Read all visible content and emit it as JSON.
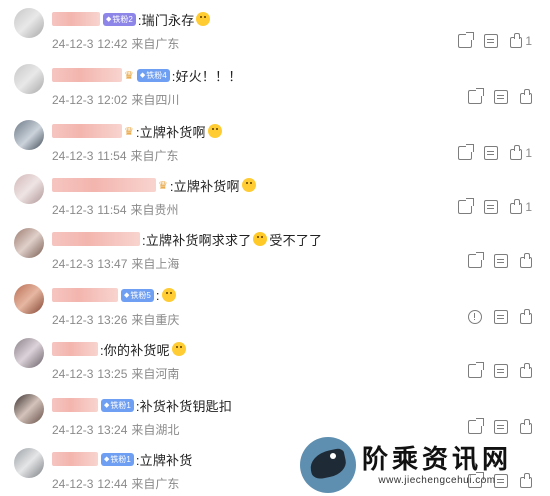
{
  "comments": [
    {
      "text": ":瑞门永存",
      "badge": "铁粉2",
      "badge_color": "purple",
      "crown": false,
      "emoji": "thumbs-up",
      "date": "24-12-3",
      "time": "12:42",
      "location": "来自广东",
      "actions": [
        "share",
        "reply",
        "like"
      ],
      "like_count": "1"
    },
    {
      "text": ":好火！！！",
      "badge": "铁粉4",
      "badge_color": "blue",
      "crown": true,
      "emoji": "",
      "date": "24-12-3",
      "time": "12:02",
      "location": "来自四川",
      "actions": [
        "share",
        "reply",
        "like"
      ],
      "like_count": ""
    },
    {
      "text": ":立牌补货啊",
      "badge": "",
      "badge_color": "",
      "crown": true,
      "emoji": "smile",
      "date": "24-12-3",
      "time": "11:54",
      "location": "来自广东",
      "actions": [
        "share",
        "reply",
        "like"
      ],
      "like_count": "1"
    },
    {
      "text": ":立牌补货啊",
      "badge": "",
      "badge_color": "",
      "crown": true,
      "emoji": "smile",
      "date": "24-12-3",
      "time": "11:54",
      "location": "来自贵州",
      "actions": [
        "share",
        "reply",
        "like"
      ],
      "like_count": "1"
    },
    {
      "text": ":立牌补货啊求求了",
      "text2": "受不了了",
      "badge": "",
      "badge_color": "",
      "crown": false,
      "emoji": "cry",
      "date": "24-12-3",
      "time": "13:47",
      "location": "来自上海",
      "actions": [
        "share",
        "reply",
        "like"
      ],
      "like_count": ""
    },
    {
      "text": ":",
      "badge": "铁粉5",
      "badge_color": "blue",
      "crown": false,
      "emoji": "smile",
      "date": "24-12-3",
      "time": "13:26",
      "location": "来自重庆",
      "actions": [
        "report",
        "reply",
        "like"
      ],
      "like_count": ""
    },
    {
      "text": ":你的补货呢",
      "badge": "",
      "badge_color": "",
      "crown": false,
      "emoji": "smile",
      "date": "24-12-3",
      "time": "13:25",
      "location": "来自河南",
      "actions": [
        "share",
        "reply",
        "like"
      ],
      "like_count": ""
    },
    {
      "text": ":补货补货钥匙扣",
      "badge": "铁粉1",
      "badge_color": "blue",
      "crown": false,
      "emoji": "",
      "date": "24-12-3",
      "time": "13:24",
      "location": "来自湖北",
      "actions": [
        "share",
        "reply",
        "like"
      ],
      "like_count": ""
    },
    {
      "text": ":立牌补货",
      "badge": "铁粉1",
      "badge_color": "blue",
      "crown": false,
      "emoji": "",
      "date": "24-12-3",
      "time": "12:44",
      "location": "来自广东",
      "actions": [
        "share",
        "reply",
        "like"
      ],
      "like_count": ""
    }
  ],
  "watermark": {
    "title": "阶乘资讯网",
    "url": "www.jiechengcehui.com"
  }
}
